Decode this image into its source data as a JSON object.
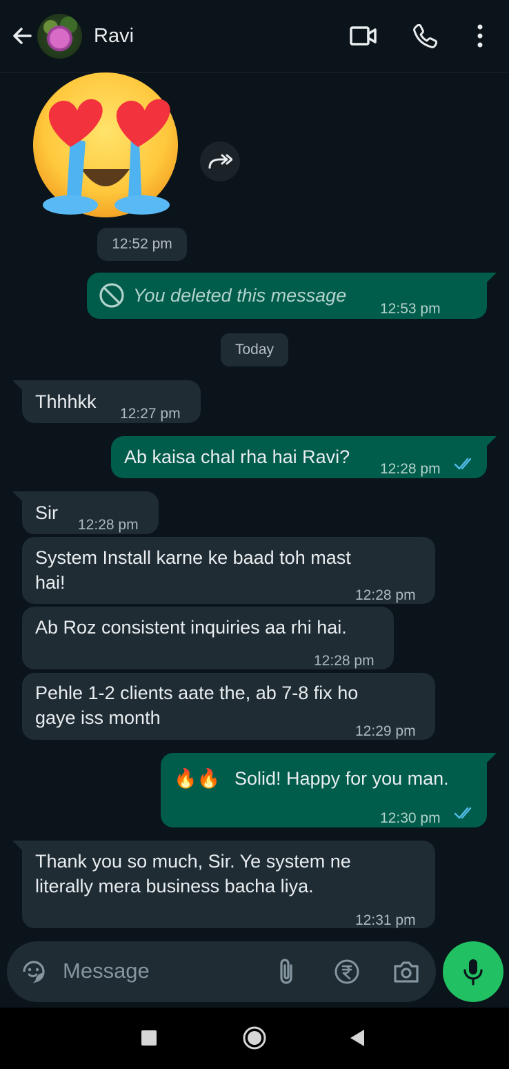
{
  "header": {
    "contact_name": "Ravi"
  },
  "sticker": {
    "emoji": "heart-eyes-crying-face",
    "time": "12:52 pm"
  },
  "messages": {
    "deleted": {
      "text": "You deleted this message",
      "time": "12:53 pm"
    },
    "date_divider": "Today",
    "m1": {
      "text": "Thhhkk",
      "time": "12:27 pm"
    },
    "m2": {
      "text": "Ab kaisa chal rha hai Ravi?",
      "time": "12:28 pm",
      "status": "read"
    },
    "m3": {
      "text": "Sir",
      "time": "12:28 pm"
    },
    "m4": {
      "line1": "System Install karne ke baad toh mast",
      "line2": "hai!",
      "time": "12:28 pm"
    },
    "m5": {
      "text": "Ab Roz consistent inquiries aa rhi hai.",
      "time": "12:28 pm"
    },
    "m6": {
      "line1": "Pehle 1-2 clients aate the, ab 7-8 fix ho",
      "line2": "gaye iss month",
      "time": "12:29 pm"
    },
    "m7": {
      "emoji": "🔥🔥",
      "text": "Solid! Happy for you man.",
      "time": "12:30 pm",
      "status": "read"
    },
    "m8": {
      "line1": "Thank you so much, Sir. Ye system ne",
      "line2": "literally mera business bacha liya.",
      "time": "12:31 pm"
    }
  },
  "composer": {
    "placeholder": "Message"
  },
  "colors": {
    "background": "#0b141a",
    "incoming_bubble": "#1f2c34",
    "outgoing_bubble": "#005c4b",
    "mic_button": "#21c063",
    "read_ticks": "#53bdeb"
  }
}
